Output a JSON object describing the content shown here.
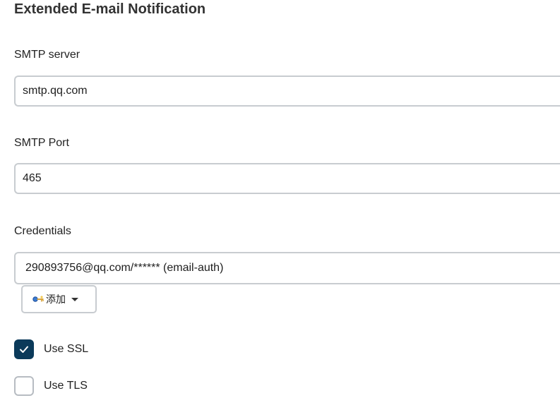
{
  "section": {
    "title": "Extended E-mail Notification"
  },
  "smtp_server": {
    "label": "SMTP server",
    "value": "smtp.qq.com"
  },
  "smtp_port": {
    "label": "SMTP Port",
    "value": "465"
  },
  "credentials": {
    "label": "Credentials",
    "selected": "290893756@qq.com/****** (email-auth)",
    "add_button_label": "添加",
    "add_button_icon": "key-icon"
  },
  "use_ssl": {
    "label": "Use SSL",
    "checked": true
  },
  "use_tls": {
    "label": "Use TLS",
    "checked": false
  },
  "colors": {
    "checkbox_checked": "#0b3a5a",
    "input_border": "#c8ccd0"
  }
}
